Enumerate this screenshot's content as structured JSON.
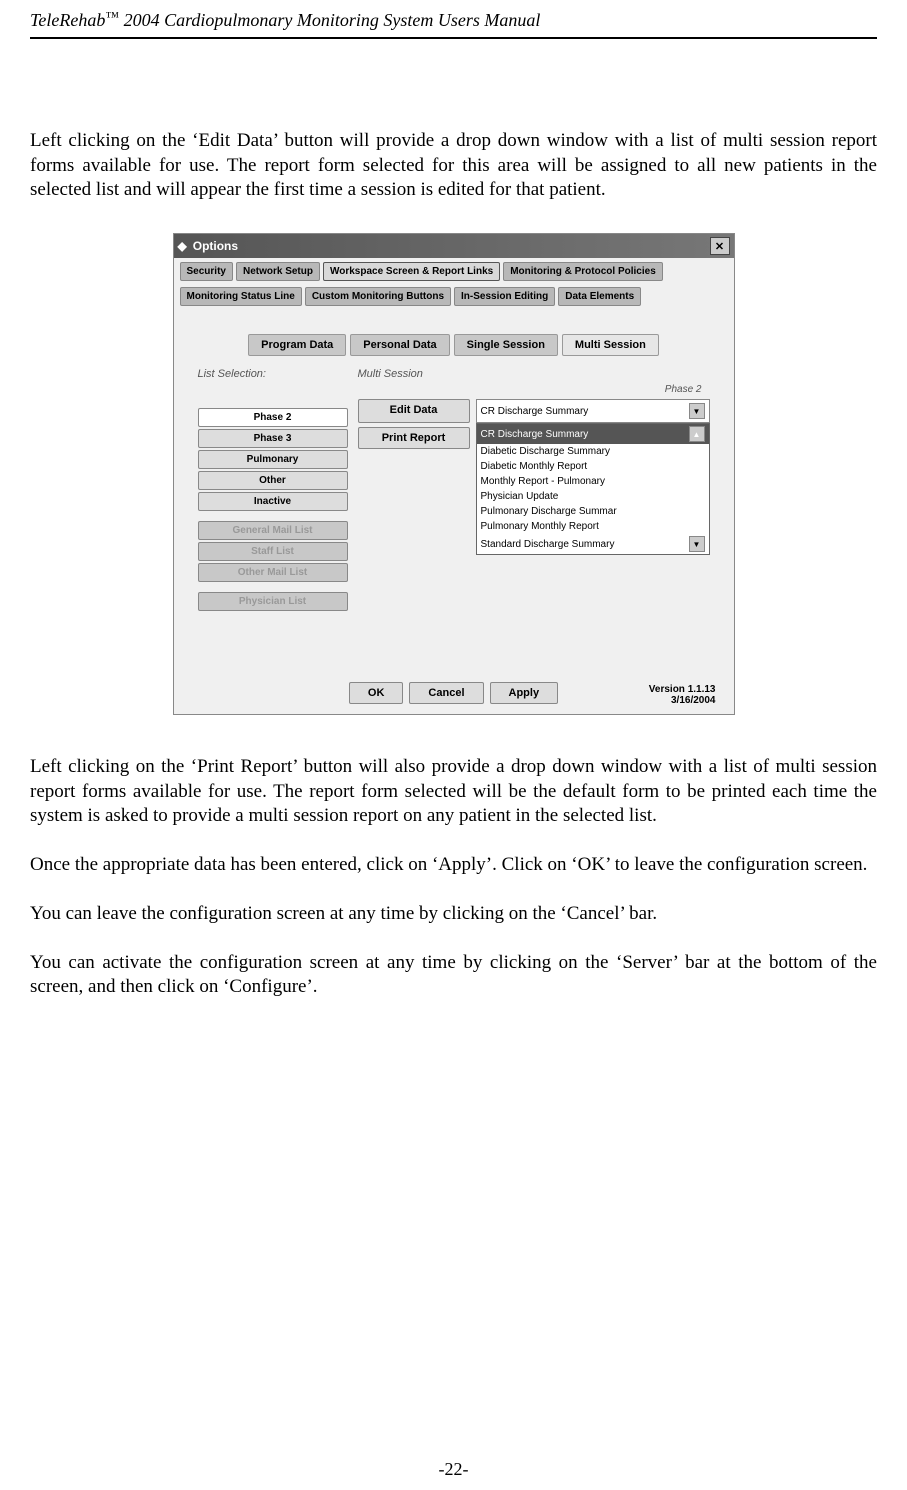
{
  "header": {
    "product": "TeleRehab",
    "tm": "™",
    "rest": " 2004 Cardiopulmonary Monitoring System Users Manual"
  },
  "paragraphs": {
    "p1": "Left clicking on the ‘Edit Data’ button will provide a drop down window with a list of multi session report forms available for use.  The report form selected for this area will be assigned to all new patients in the selected list and will appear the first time a session is edited for that patient.",
    "p2": "Left clicking on the ‘Print Report’ button will also provide a drop down window with a list of multi session report forms available for use. The report form selected will be the default form to be printed each time the system is asked to provide a multi session report on any patient in the selected list.",
    "p3": "Once the appropriate data has been entered, click on ‘Apply’. Click on ‘OK’ to leave the configuration screen.",
    "p4": "You can leave the configuration screen at any time by clicking on the ‘Cancel’ bar.",
    "p5": "You can activate the configuration screen at any time by clicking on the ‘Server’ bar at the bottom of the screen, and then click on ‘Configure’."
  },
  "window": {
    "title": "Options",
    "top_tabs": [
      "Security",
      "Network Setup",
      "Workspace Screen & Report Links",
      "Monitoring & Protocol Policies"
    ],
    "top_tabs2": [
      "Monitoring Status Line",
      "Custom Monitoring Buttons",
      "In-Session Editing",
      "Data Elements"
    ],
    "top_tabs_active": 2,
    "sub_tabs": [
      "Program Data",
      "Personal Data",
      "Single Session",
      "Multi Session"
    ],
    "sub_tab_active": 3,
    "list_selection_label": "List Selection:",
    "multi_session_label": "Multi Session",
    "phase_label": "Phase 2",
    "phase_buttons": [
      "Phase 2",
      "Phase 3",
      "Pulmonary",
      "Other",
      "Inactive"
    ],
    "disabled_buttons": [
      "General Mail List",
      "Staff List",
      "Other Mail List"
    ],
    "physician_button": "Physician List",
    "edit_data_label": "Edit Data",
    "print_report_label": "Print Report",
    "dropdown_selected": "CR Discharge Summary",
    "dropdown_items": [
      "CR Discharge Summary",
      "Diabetic Discharge Summary",
      "Diabetic Monthly Report",
      "Monthly Report - Pulmonary",
      "Physician Update",
      "Pulmonary Discharge Summar",
      "Pulmonary Monthly Report",
      "Standard Discharge Summary"
    ],
    "dropdown_highlighted": 0,
    "ok_label": "OK",
    "cancel_label": "Cancel",
    "apply_label": "Apply",
    "version_line1": "Version 1.1.13",
    "version_line2": "3/16/2004"
  },
  "footer": {
    "page_number": "-22-"
  }
}
